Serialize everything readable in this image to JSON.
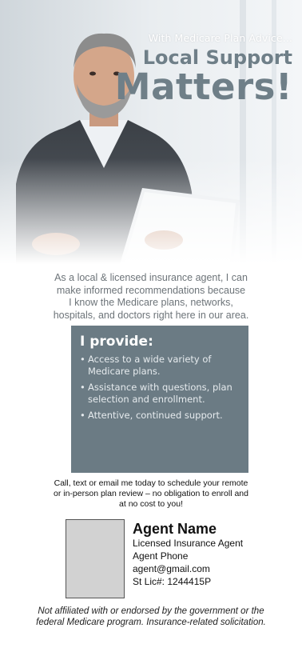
{
  "headline": {
    "kicker": "With Medicare Plan Advice...",
    "line1": "Local Support",
    "line2": "Matters!"
  },
  "intro": {
    "lines": [
      "As a local & licensed insurance agent, I can",
      "make informed recommendations because",
      "I know the Medicare plans, networks,",
      "hospitals, and doctors right here in our area."
    ]
  },
  "provide": {
    "title": "I provide:",
    "bullet": "•",
    "items": [
      "Access to a wide variety of Medicare plans.",
      "Assistance with questions, plan selection and enrollment.",
      "Attentive, continued support."
    ]
  },
  "cta": {
    "lines": [
      "Call, text or email me today to schedule your remote",
      "or in-person plan review – no obligation to enroll and",
      "at no cost to you!"
    ]
  },
  "agent": {
    "name": "Agent Name",
    "title": "Licensed Insurance Agent",
    "phone": "Agent Phone",
    "email": "agent@gmail.com",
    "license": "St Lic#: 1244415P"
  },
  "disclaimer": {
    "lines": [
      "Not affiliated with or endorsed by the government or the",
      "federal Medicare program. Insurance-related solicitation."
    ]
  },
  "colors": {
    "accent": "#6f7f88",
    "panel": "#6b7b84",
    "photo_placeholder": "#d2d2d2"
  }
}
